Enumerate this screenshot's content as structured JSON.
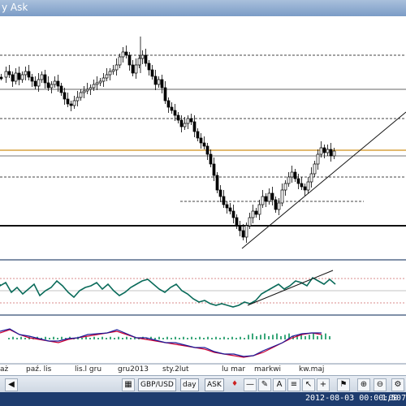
{
  "window": {
    "title": "y Ask"
  },
  "x_axis": {
    "labels": [
      "aż",
      "paź. lis",
      "lis.l gru",
      "gru2013",
      "sty.2lut",
      "lu mar",
      "markwi",
      "kw.maj"
    ]
  },
  "toolbar": {
    "symbol": "GBP/USD",
    "period": "day",
    "price_type": "ASK"
  },
  "status": {
    "datetime": "2012-08-03 00:00:00",
    "value": "1,5076"
  },
  "colors": {
    "candle": "#000000",
    "indicator_line": "#0a6b5a",
    "ma_fast": "#cc0033",
    "ma_slow": "#1a1a99",
    "histogram": "#3aa77a",
    "horizontal_gold": "#d9a441",
    "status_bg": "#1e3c6e"
  },
  "icons": [
    "drop-down-arrow-icon",
    "red-line-marker-icon",
    "cursor-icon",
    "zoom-in-icon",
    "zoom-out-icon",
    "flag-icon",
    "settings-icon",
    "indicator-icon"
  ]
}
